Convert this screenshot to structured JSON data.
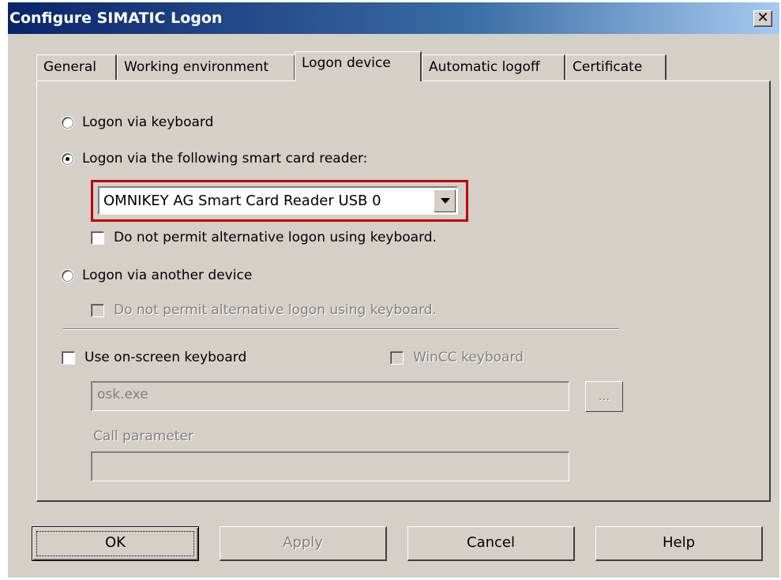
{
  "window": {
    "title": "Configure SIMATIC Logon",
    "close_glyph": "✕"
  },
  "tabs": [
    {
      "label": "General",
      "active": false
    },
    {
      "label": "Working environment",
      "active": false
    },
    {
      "label": "Logon device",
      "active": true
    },
    {
      "label": "Automatic logoff",
      "active": false
    },
    {
      "label": "Certificate",
      "active": false
    }
  ],
  "logon_options": {
    "keyboard_label": "Logon via keyboard",
    "smart_card_label": "Logon via the following smart card reader:",
    "smart_card_reader_value": "OMNIKEY AG Smart Card Reader USB 0",
    "smart_card_no_keyboard_label": "Do not permit alternative logon using keyboard.",
    "another_device_label": "Logon via another device",
    "another_device_no_keyboard_label": "Do not permit alternative logon using keyboard.",
    "selected": "smart_card"
  },
  "onscreen_keyboard": {
    "label": "Use on-screen keyboard",
    "checked": false,
    "wincc_label": "WinCC keyboard",
    "program_value": "osk.exe",
    "browse_label": "...",
    "call_parameter_label": "Call parameter",
    "call_parameter_value": ""
  },
  "buttons": {
    "ok": "OK",
    "apply": "Apply",
    "cancel": "Cancel",
    "help": "Help"
  },
  "colors": {
    "highlight_box": "#c00000",
    "dialog_face": "#d4d0c8",
    "titlebar_start": "#0a246a"
  }
}
